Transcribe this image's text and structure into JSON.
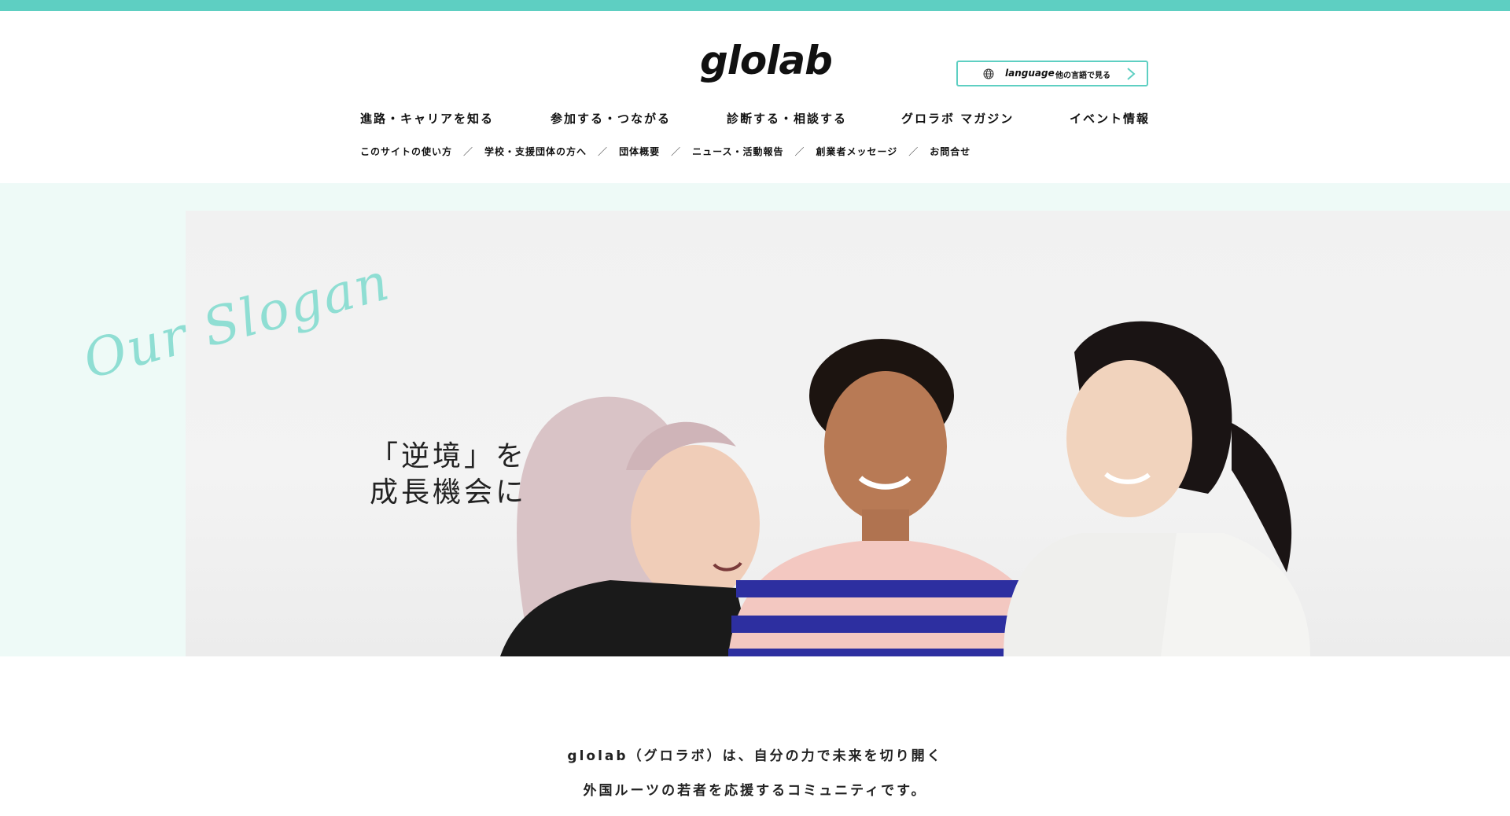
{
  "brand": {
    "logo_text": "glolab",
    "accent_color": "#5ecfc2"
  },
  "language_button": {
    "label": "language",
    "sub_label": "他の言語で見る",
    "icon": "globe-icon",
    "arrow_icon": "chevron-right-icon"
  },
  "main_nav": [
    {
      "label": "進路・キャリアを知る"
    },
    {
      "label": "参加する・つながる"
    },
    {
      "label": "診断する・相談する"
    },
    {
      "label": "グロラボ マガジン"
    },
    {
      "label": "イベント情報"
    }
  ],
  "sub_nav": [
    {
      "label": "このサイトの使い方"
    },
    {
      "label": "学校・支援団体の方へ"
    },
    {
      "label": "団体概要"
    },
    {
      "label": "ニュース・活動報告"
    },
    {
      "label": "創業者メッセージ"
    },
    {
      "label": "お問合せ"
    }
  ],
  "sub_nav_separator": "／",
  "hero": {
    "script_text": "Our Slogan",
    "slogan_line1": "「逆境」を",
    "slogan_line2": "成長機会に"
  },
  "intro": {
    "line1": "glolab（グロラボ）は、自分の力で未来を切り開く",
    "line2": "外国ルーツの若者を応援するコミュニティです。"
  }
}
